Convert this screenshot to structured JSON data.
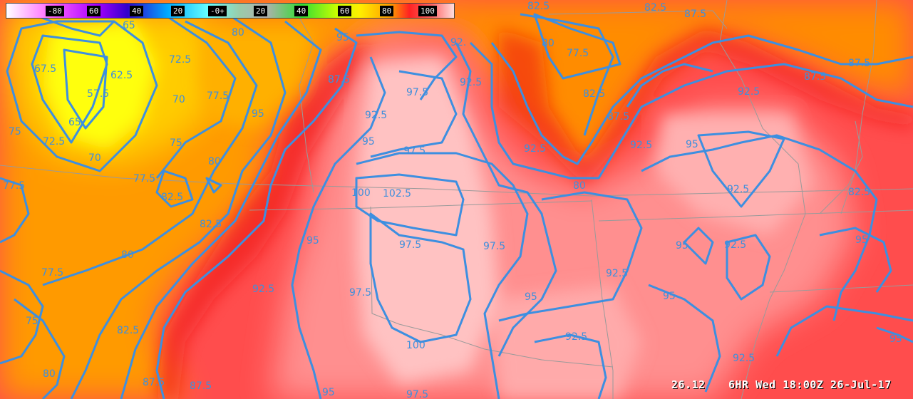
{
  "colorbar": {
    "labels": [
      "-80",
      "60",
      "40",
      "20",
      "-0+",
      "20",
      "40",
      "60",
      "80",
      "100"
    ]
  },
  "footer": {
    "value": "26.12",
    "time": "6HR Wed 18:00Z 26-Jul-17"
  },
  "colors": {
    "contour": "#3d8fe0",
    "border": "#9a9a9a"
  },
  "contour_labels": [
    "65",
    "80",
    "82.5",
    "87.5",
    "95",
    "92.",
    "82.5",
    "87.5",
    "67.5",
    "62.5",
    "72.5",
    "57.5",
    "80",
    "77.5",
    "70",
    "77.5",
    "97.5",
    "92.5",
    "82.5",
    "87.5",
    "92.5",
    "75",
    "72.5",
    "65",
    "75",
    "70",
    "80",
    "95",
    "92.5",
    "92.5",
    "95",
    "77.5",
    "82.5",
    "100",
    "102.5",
    "97.5",
    "82.5",
    "95",
    "97.5",
    "97.5",
    "95",
    "92.5",
    "82.5",
    "80",
    "77.5",
    "92.5",
    "97.5",
    "95",
    "95",
    "92.5",
    "75",
    "82.5",
    "100",
    "92.5",
    "80",
    "87.5",
    "95",
    "97.5",
    "95",
    "92.5",
    "87.5",
    "95",
    "92.5",
    "92.5",
    "95",
    "80",
    "87.5",
    "87.5",
    "77.5"
  ]
}
